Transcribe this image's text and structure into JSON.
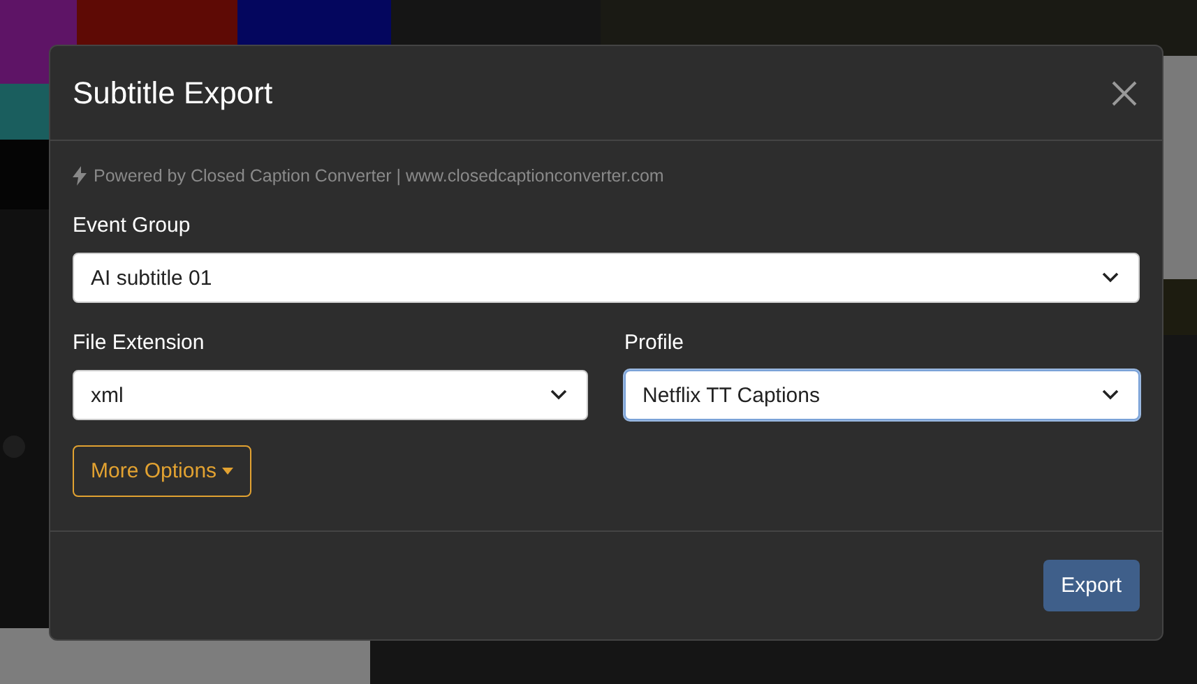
{
  "dialog": {
    "title": "Subtitle Export",
    "credit": "Powered by Closed Caption Converter | www.closedcaptionconverter.com",
    "fields": [
      {
        "label": "Event Group",
        "value": "AI subtitle 01",
        "focused": false,
        "wide": true
      },
      {
        "label": "File Extension",
        "value": "xml",
        "focused": false,
        "wide": false
      },
      {
        "label": "Profile",
        "value": "Netflix TT Captions",
        "focused": true,
        "wide": false
      }
    ],
    "more_options": "More Options",
    "export_button": "Export"
  }
}
